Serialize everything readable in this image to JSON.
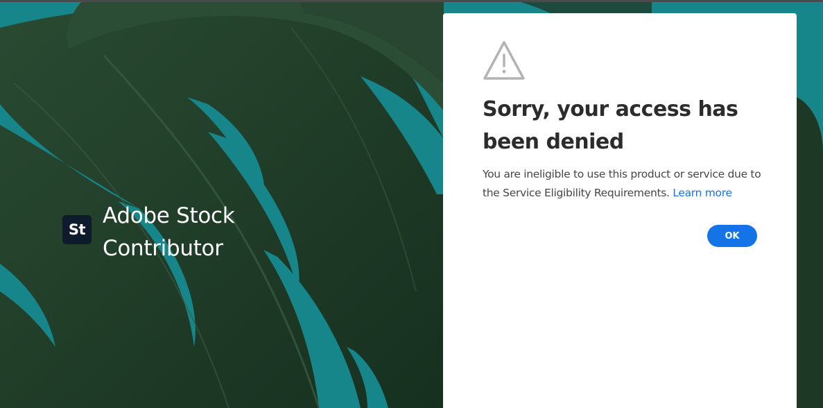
{
  "brand": {
    "logo_text": "St",
    "name_line1": "Adobe Stock",
    "name_line2": "Contributor"
  },
  "dialog": {
    "icon": "warning-triangle-icon",
    "title": "Sorry, your access has been denied",
    "message": "You are ineligible to use this product or service due to the Service Eligibility Requirements.",
    "link_label": "Learn more",
    "ok_label": "OK"
  },
  "colors": {
    "background_teal": "#16868a",
    "leaf_green": "#1e3a26",
    "accent_blue": "#1473e6",
    "logo_bg": "#0e1b2c"
  }
}
